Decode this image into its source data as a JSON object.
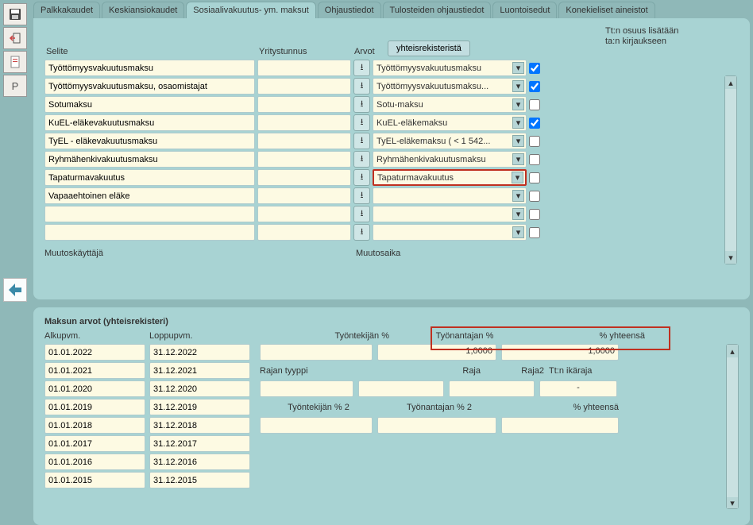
{
  "toolbar_icons": [
    "disk-icon",
    "exit-icon",
    "doc-icon",
    "p-icon"
  ],
  "p_label": "P",
  "tabs": [
    {
      "label": "Palkkakaudet",
      "active": false
    },
    {
      "label": "Keskiansiokaudet",
      "active": false
    },
    {
      "label": "Sosiaalivakuutus- ym. maksut",
      "active": true
    },
    {
      "label": "Ohjaustiedot",
      "active": false
    },
    {
      "label": "Tulosteiden ohjaustiedot",
      "active": false
    },
    {
      "label": "Luontoisedut",
      "active": false
    },
    {
      "label": "Konekieliset aineistot",
      "active": false
    }
  ],
  "panel_a": {
    "hdr_selite": "Selite",
    "hdr_yt": "Yritystunnus",
    "hdr_arvot": "Arvot",
    "btn_yhteis": "yhteisrekisteristä",
    "tt_line1": "Tt:n osuus lisätään",
    "tt_line2": "ta:n kirjaukseen",
    "rows": [
      {
        "selite": "Työttömyysvakuutusmaksu",
        "dd": "Työttömyysvakuutusmaksu",
        "chk": true,
        "hl": false
      },
      {
        "selite": "Työttömyysvakuutusmaksu, osaomistajat",
        "dd": "Työttömyysvakuutusmaksu...",
        "chk": true,
        "hl": false
      },
      {
        "selite": "Sotumaksu",
        "dd": "Sotu-maksu",
        "chk": false,
        "hl": false
      },
      {
        "selite": "KuEL-eläkevakuutusmaksu",
        "dd": "KuEL-eläkemaksu",
        "chk": true,
        "hl": false
      },
      {
        "selite": "TyEL - eläkevakuutusmaksu",
        "dd": "TyEL-eläkemaksu ( < 1 542...",
        "chk": false,
        "hl": false
      },
      {
        "selite": "Ryhmähenkivakuutusmaksu",
        "dd": "Ryhmähenkivakuutusmaksu",
        "chk": false,
        "hl": false
      },
      {
        "selite": "Tapaturmavakuutus",
        "dd": "Tapaturmavakuutus",
        "chk": false,
        "hl": true
      },
      {
        "selite": "Vapaaehtoinen eläke",
        "dd": "",
        "chk": false,
        "hl": false
      },
      {
        "selite": "",
        "dd": "",
        "chk": false,
        "hl": false
      },
      {
        "selite": "",
        "dd": "",
        "chk": false,
        "hl": false
      }
    ],
    "footer_muutos": "Muutoskäyttäjä",
    "footer_aika": "Muutosaika"
  },
  "panel_b": {
    "title": "Maksun arvot (yhteisrekisteri)",
    "hdr_alku": "Alkupvm.",
    "hdr_loppu": "Loppupvm.",
    "hdr_tp": "Työntekijän %",
    "hdr_ta": "Työnantajan %",
    "hdr_yh": "% yhteensä",
    "ta_val": "1,0000",
    "yh_val": "1,0000",
    "lbl_rajan": "Rajan tyyppi",
    "lbl_raja": "Raja",
    "lbl_raja2": "Raja2",
    "lbl_ttika": "Tt:n ikäraja",
    "lbl_tp2": "Työntekijän % 2",
    "lbl_ta2": "Työnantajan % 2",
    "lbl_yh2": "% yhteensä",
    "ika_val": "-",
    "dates_start": [
      "01.01.2022",
      "01.01.2021",
      "01.01.2020",
      "01.01.2019",
      "01.01.2018",
      "01.01.2017",
      "01.01.2016",
      "01.01.2015"
    ],
    "dates_end": [
      "31.12.2022",
      "31.12.2021",
      "31.12.2020",
      "31.12.2019",
      "31.12.2018",
      "31.12.2017",
      "31.12.2016",
      "31.12.2015"
    ]
  }
}
